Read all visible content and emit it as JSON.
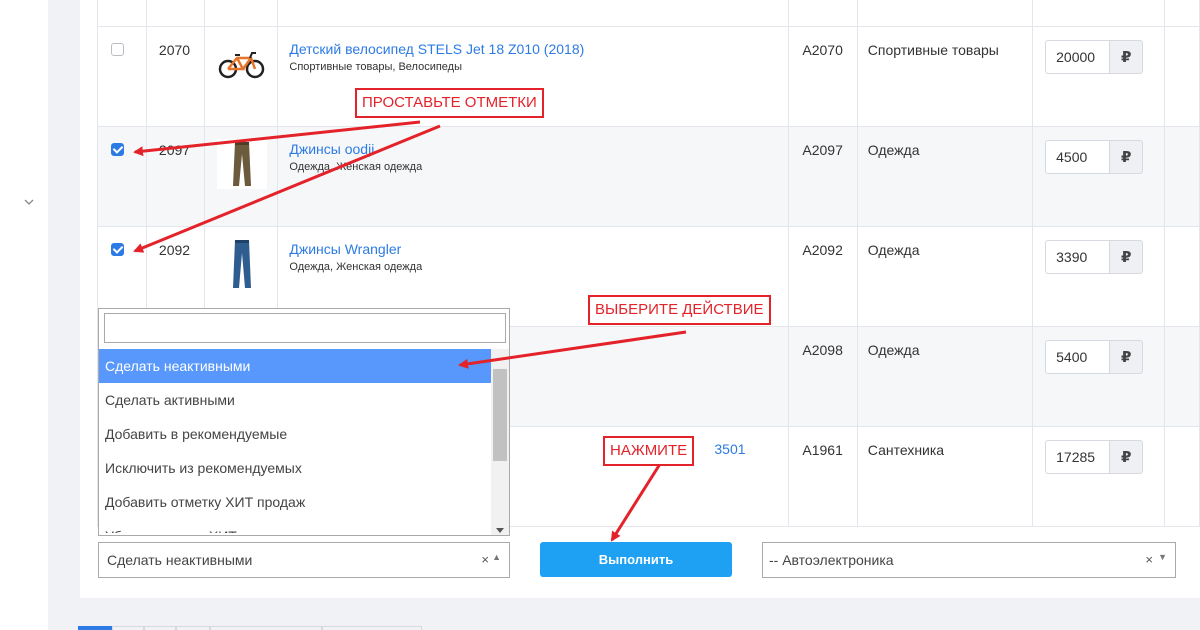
{
  "table": {
    "rows": [
      {
        "id": "2070",
        "checked": false,
        "name": "Детский велосипед STELS Jet 18 Z010 (2018)",
        "categories": "Спортивные товары, Велосипеды",
        "sku": "A2070",
        "category": "Спортивные товары",
        "price": "20000",
        "currency": "₽",
        "image": "bicycle-icon"
      },
      {
        "id": "2097",
        "checked": true,
        "name": "Джинсы oodji",
        "categories": "Одежда, Женская одежда",
        "sku": "A2097",
        "category": "Одежда",
        "price": "4500",
        "currency": "₽",
        "image": "pants-icon"
      },
      {
        "id": "2092",
        "checked": true,
        "name": "Джинсы Wrangler",
        "categories": "Одежда, Женская одежда",
        "sku": "A2092",
        "category": "Одежда",
        "price": "3390",
        "currency": "₽",
        "image": "jeans-icon"
      },
      {
        "sku": "A2098",
        "category": "Одежда",
        "price": "5400",
        "currency": "₽"
      },
      {
        "name_suffix": "3501",
        "sku": "A1961",
        "category": "Сантехника",
        "price": "17285",
        "currency": "₽"
      }
    ]
  },
  "bulk_action": {
    "options": [
      "Сделать неактивными",
      "Сделать активными",
      "Добавить в рекомендуемые",
      "Исключить из рекомендуемых",
      "Добавить отметку ХИТ продаж",
      "Убрать отметку ХИТ продаж"
    ],
    "highlighted_index": 0,
    "selected": "Сделать неактивными",
    "clear": "×",
    "caret": "▲"
  },
  "run_button": {
    "label": "Выполнить"
  },
  "category_select": {
    "value": "-- Автоэлектроника",
    "clear": "×",
    "caret": "▼"
  },
  "annotations": {
    "mark": "ПРОСТАВЬТЕ ОТМЕТКИ",
    "choose": "ВЫБЕРИТЕ ДЕЙСТВИЕ",
    "press": "НАЖМИТЕ"
  },
  "colors": {
    "link": "#2c7be5",
    "button": "#1ea1f2",
    "highlight": "#5897fb",
    "annotation": "#e3222a"
  }
}
